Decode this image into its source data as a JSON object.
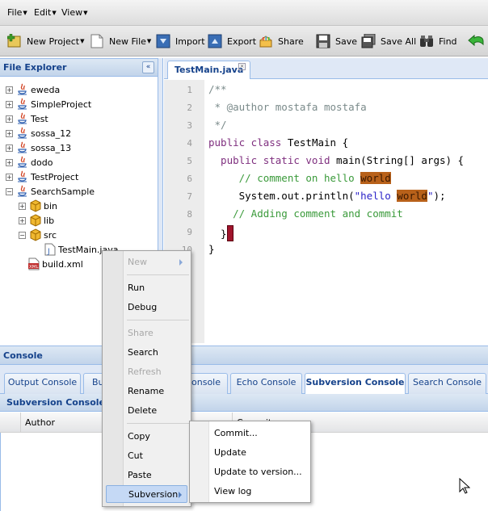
{
  "menubar": {
    "items": [
      {
        "label": "File"
      },
      {
        "label": "Edit"
      },
      {
        "label": "View"
      }
    ]
  },
  "toolbar": {
    "new_project": "New Project",
    "new_file": "New File",
    "import": "Import",
    "export": "Export",
    "share": "Share",
    "save": "Save",
    "save_all": "Save All",
    "find": "Find"
  },
  "file_explorer": {
    "title": "File Explorer",
    "collapse_glyph": "«",
    "projects": [
      "eweda",
      "SimpleProject",
      "Test",
      "sossa_12",
      "sossa_13",
      "dodo",
      "TestProject",
      "SearchSample"
    ],
    "search_sample_children": {
      "bin": "bin",
      "lib": "lib",
      "src": "src",
      "file": "TestMain.java",
      "build": "build.xml"
    }
  },
  "editor": {
    "tab_label": "TestMain.java",
    "line_numbers": [
      "1",
      "2",
      "3",
      "4",
      "5",
      "6",
      "7",
      "8",
      "9",
      "10"
    ],
    "lines": {
      "l1": "/**",
      "l2": " * @author mostafa mostafa",
      "l3": " */",
      "l4_kw": "public class",
      "l4_rest": " TestMain {",
      "l5_kw": "  public static void",
      "l5_rest": " main(String[] args) {",
      "l6_cm": "     // comment on hello ",
      "l6_hl": "world",
      "l7_a": "     System.out.println(",
      "l7_str": "\"hello ",
      "l7_hl": "world",
      "l7_str2": "\"",
      "l7_end": ");",
      "l8": "    // Adding comment and commit",
      "l9": "  }",
      "l10": "}"
    }
  },
  "console": {
    "title": "Console",
    "tabs": [
      "Output Console",
      "Bu",
      "Console",
      "Echo Console",
      "Subversion Console",
      "Search Console"
    ],
    "sub_title": "Subversion Console",
    "columns": [
      "Author",
      "Commit"
    ]
  },
  "context_menu": {
    "items": {
      "new": "New",
      "run": "Run",
      "debug": "Debug",
      "share": "Share",
      "search": "Search",
      "refresh": "Refresh",
      "rename": "Rename",
      "delete": "Delete",
      "copy": "Copy",
      "cut": "Cut",
      "paste": "Paste",
      "subversion": "Subversion"
    }
  },
  "subversion_menu": {
    "items": [
      "Commit...",
      "Update",
      "Update to version...",
      "View log"
    ]
  },
  "colors": {
    "panel_header": "#c2d4ea",
    "accent": "#15428b",
    "highlight": "#b8611a"
  }
}
